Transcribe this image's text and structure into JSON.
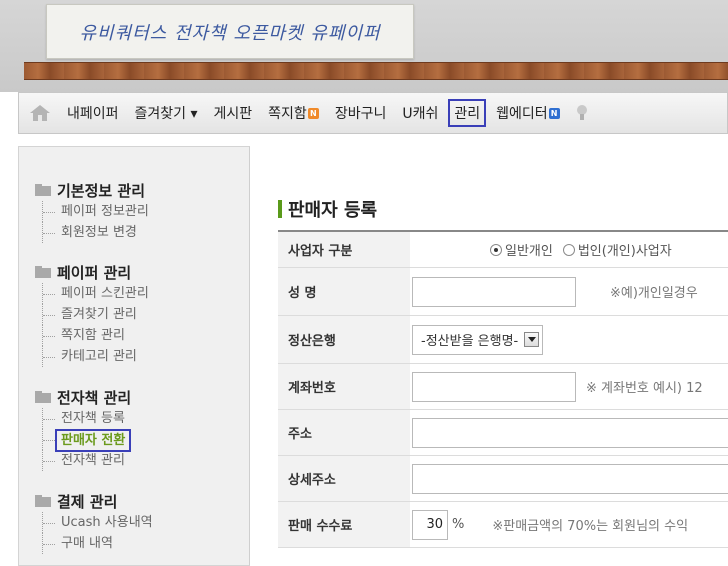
{
  "header": {
    "logo_text": "유비쿼터스 전자책 오픈마켓 유페이퍼"
  },
  "nav": {
    "items": [
      {
        "label": "내페이퍼"
      },
      {
        "label": "즐겨찾기 ▾"
      },
      {
        "label": "게시판"
      },
      {
        "label": "쪽지함"
      },
      {
        "label": "장바구니"
      },
      {
        "label": "U캐쉬"
      },
      {
        "label": "관리"
      },
      {
        "label": "웹에디터"
      }
    ],
    "badges": {
      "message": "N",
      "editor": "N"
    },
    "highlighted": "관리"
  },
  "sidebar": {
    "groups": [
      {
        "title": "기본정보 관리",
        "items": [
          "페이퍼 정보관리",
          "회원정보 변경"
        ]
      },
      {
        "title": "페이퍼 관리",
        "items": [
          "페이퍼 스킨관리",
          "즐겨찾기 관리",
          "쪽지함 관리",
          "카테고리 관리"
        ]
      },
      {
        "title": "전자책 관리",
        "items": [
          "전자책 등록",
          "판매자 전환",
          "전자책 관리"
        ]
      },
      {
        "title": "결제 관리",
        "items": [
          "Ucash 사용내역",
          "구매 내역"
        ]
      }
    ],
    "active_item": "판매자 전환"
  },
  "form": {
    "title": "판매자 등록",
    "business_type": {
      "label": "사업자 구분",
      "options": [
        "일반개인",
        "법인(개인)사업자"
      ],
      "selected": "일반개인"
    },
    "name": {
      "label": "성 명",
      "value": "",
      "hint": "※예)개인일경우"
    },
    "bank": {
      "label": "정산은행",
      "selected": "-정산받을 은행명-"
    },
    "account": {
      "label": "계좌번호",
      "value": "",
      "hint": "※ 계좌번호 예시) 12"
    },
    "address": {
      "label": "주소",
      "value": ""
    },
    "address_detail": {
      "label": "상세주소",
      "value": ""
    },
    "commission": {
      "label": "판매 수수료",
      "value": "30",
      "unit": "%",
      "hint": "※판매금액의 70%는 회원님의 수익"
    }
  },
  "colors": {
    "highlight_border": "#3a3fb8",
    "active_green": "#6b9a1c",
    "title_bar": "#5a9a1a"
  }
}
